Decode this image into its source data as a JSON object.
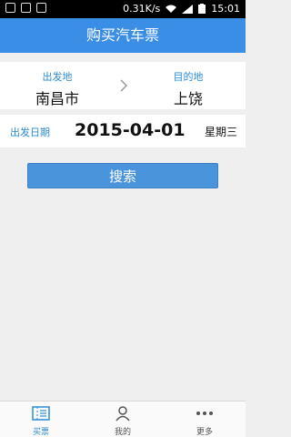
{
  "status_bar": {
    "speed": "0.31K/s",
    "time": "15:01"
  },
  "app_bar": {
    "title": "购买汽车票"
  },
  "route": {
    "from_label": "出发地",
    "from_city": "南昌市",
    "to_label": "目的地",
    "to_city": "上饶"
  },
  "date": {
    "label": "出发日期",
    "value": "2015-04-01",
    "weekday": "星期三"
  },
  "search_button": {
    "label": "搜索"
  },
  "tabs": [
    {
      "label": "买票",
      "icon": "ticket-icon"
    },
    {
      "label": "我的",
      "icon": "user-icon"
    },
    {
      "label": "更多",
      "icon": "more-icon"
    }
  ],
  "colors": {
    "primary": "#3a8ee6",
    "accent_text": "#2a8bd6",
    "background": "#efefef"
  }
}
